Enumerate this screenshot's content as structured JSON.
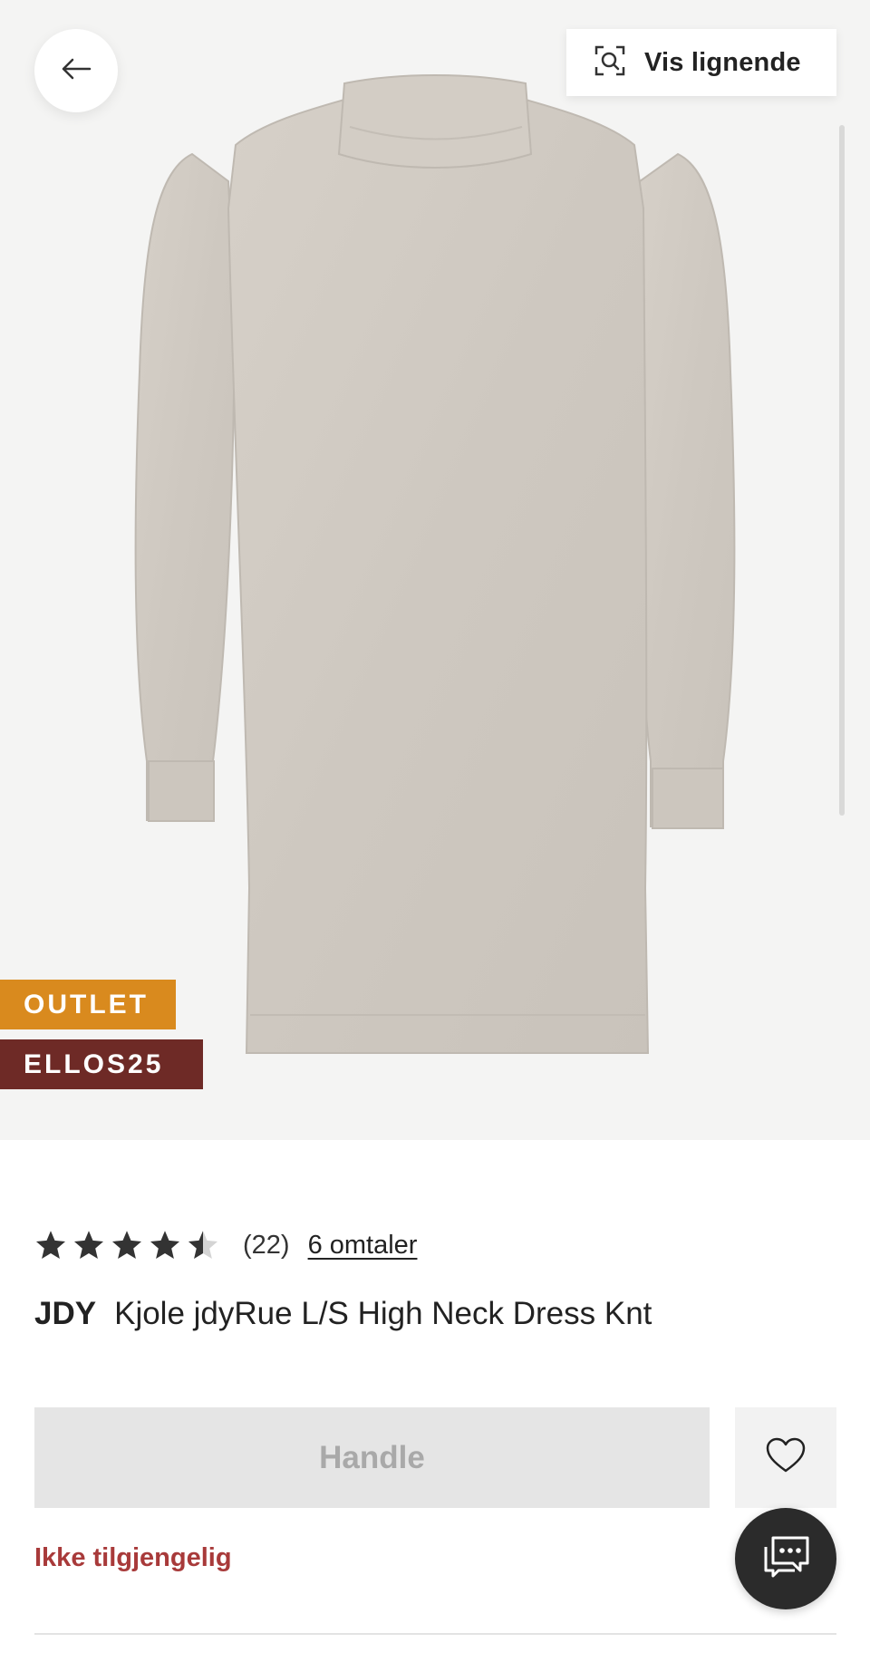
{
  "navigation": {
    "back_icon": "arrow-left-icon"
  },
  "similar": {
    "label": "Vis lignende",
    "icon": "visual-search-icon"
  },
  "badges": {
    "outlet": "OUTLET",
    "code": "ELLOS25",
    "outlet_color": "#d98a1e",
    "code_color": "#6e2a26"
  },
  "rating": {
    "stars": 4.5,
    "max_stars": 5,
    "count": "(22)",
    "reviews_link": "6 omtaler"
  },
  "product": {
    "brand": "JDY",
    "name": "Kjole jdyRue L/S High Neck Dress Knt"
  },
  "actions": {
    "buy_label": "Handle",
    "favorite_icon": "heart-icon",
    "chat_icon": "chat-icon"
  },
  "status": {
    "availability": "Ikke tilgjengelig",
    "availability_color": "#a83a3a"
  }
}
